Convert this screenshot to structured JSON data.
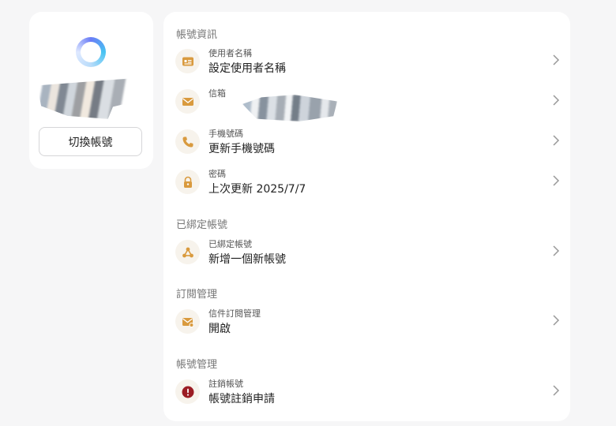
{
  "profile": {
    "switch_account_label": "切換帳號"
  },
  "sections": {
    "account_info": "帳號資訊",
    "linked_accounts": "已綁定帳號",
    "subscription": "訂閱管理",
    "account_management": "帳號管理"
  },
  "rows": {
    "username": {
      "label": "使用者名稱",
      "value": "設定使用者名稱",
      "icon": "id-card-icon"
    },
    "email": {
      "label": "信箱",
      "value": "",
      "icon": "mail-icon"
    },
    "phone": {
      "label": "手機號碼",
      "value": "更新手機號碼",
      "icon": "phone-icon"
    },
    "password": {
      "label": "密碼",
      "value": "上次更新 2025/7/7",
      "icon": "lock-icon"
    },
    "linked": {
      "label": "已綁定帳號",
      "value": "新增一個新帳號",
      "icon": "network-icon"
    },
    "mail_sub": {
      "label": "信件訂閱管理",
      "value": "開啟",
      "icon": "mail-settings-icon"
    },
    "deactivate": {
      "label": "註銷帳號",
      "value": "帳號註銷申請",
      "icon": "alert-icon"
    }
  },
  "colors": {
    "icon_accent": "#d99a3e",
    "danger": "#9b1c24",
    "section_text": "#777777"
  }
}
